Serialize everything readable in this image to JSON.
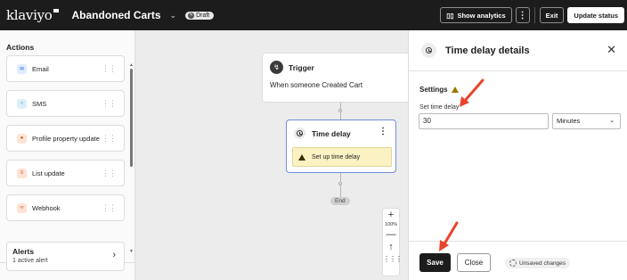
{
  "header": {
    "logo": "klaviyo",
    "flow_title": "Abandoned Carts",
    "status_badge": "Draft",
    "show_analytics": "Show analytics",
    "exit": "Exit",
    "update_status": "Update status"
  },
  "sidebar": {
    "heading": "Actions",
    "items": [
      {
        "label": "Email",
        "icon": "envelope-icon",
        "color": "#2f6fd6",
        "bg": "#e0ecff"
      },
      {
        "label": "SMS",
        "icon": "message-icon",
        "color": "#2a7fb5",
        "bg": "#dcf0fb"
      },
      {
        "label": "Profile property update",
        "icon": "person-icon",
        "color": "#c2551a",
        "bg": "#fde4d6"
      },
      {
        "label": "List update",
        "icon": "list-icon",
        "color": "#c2551a",
        "bg": "#fde4d6"
      },
      {
        "label": "Webhook",
        "icon": "webhook-icon",
        "color": "#c2551a",
        "bg": "#fde4d6"
      }
    ],
    "alerts_title": "Alerts",
    "alerts_subtitle": "1 active alert"
  },
  "canvas": {
    "trigger_label": "Trigger",
    "trigger_desc": "When someone Created Cart",
    "delay_label": "Time delay",
    "delay_warning": "Set up time delay",
    "end_label": "End",
    "zoom_level": "100%"
  },
  "panel": {
    "title": "Time delay details",
    "settings_label": "Settings",
    "field_label": "Set time delay",
    "delay_value": "30",
    "unit_value": "Minutes",
    "save": "Save",
    "cancel": "Close",
    "unsaved": "Unsaved changes"
  },
  "colors": {
    "topbar": "#1c1c1c",
    "selection_border": "#6f8fd8",
    "warning_bg": "#fbf2c3",
    "annotation_arrow": "#e8452c"
  }
}
